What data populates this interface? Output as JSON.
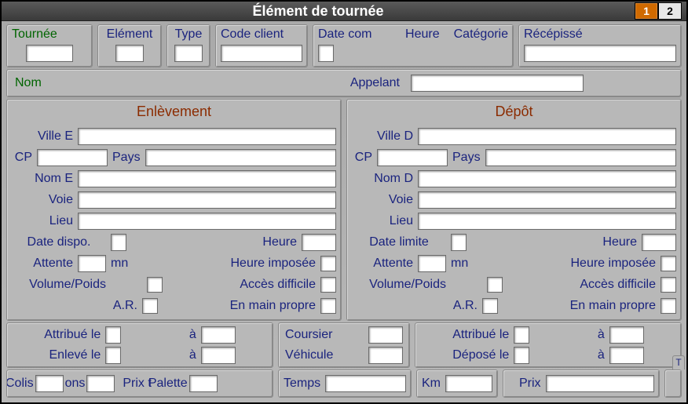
{
  "window": {
    "title": "Élément de tournée",
    "tabs": [
      "1",
      "2"
    ],
    "active_tab": "1"
  },
  "header": {
    "tournee": {
      "label": "Tournée",
      "value": ""
    },
    "element": {
      "label": "Elément",
      "value": ""
    },
    "type": {
      "label": "Type",
      "value": ""
    },
    "code_client": {
      "label": "Code client",
      "value": ""
    },
    "date_com": {
      "label": "Date com",
      "value": ""
    },
    "heure": {
      "label": "Heure",
      "value": ""
    },
    "categorie": {
      "label": "Catégorie",
      "value": ""
    },
    "recepisse": {
      "label": "Récépissé",
      "value": ""
    }
  },
  "identity": {
    "nom_label": "Nom",
    "nom": "",
    "appelant_label": "Appelant",
    "appelant": ""
  },
  "enlevement": {
    "title": "Enlèvement",
    "ville_label": "Ville E",
    "ville": "",
    "cp_label": "CP",
    "cp": "",
    "pays_label": "Pays",
    "pays": "",
    "nom_label": "Nom E",
    "nom": "",
    "voie_label": "Voie",
    "voie": "",
    "lieu_label": "Lieu",
    "lieu": "",
    "date_dispo_label": "Date dispo.",
    "date_dispo": "",
    "heure_label": "Heure",
    "heure": "",
    "attente_label": "Attente",
    "attente": "",
    "mn_label": "mn",
    "heure_imposee_label": "Heure imposée",
    "heure_imposee": "",
    "volpoids_label": "Volume/Poids",
    "volpoids": "",
    "acces_label": "Accès difficile",
    "acces": "",
    "ar_label": "A.R.",
    "ar": "",
    "enmain_label": "En main propre",
    "enmain": ""
  },
  "depot": {
    "title": "Dépôt",
    "ville_label": "Ville D",
    "ville": "",
    "cp_label": "CP",
    "cp": "",
    "pays_label": "Pays",
    "pays": "",
    "nom_label": "Nom D",
    "nom": "",
    "voie_label": "Voie",
    "voie": "",
    "lieu_label": "Lieu",
    "lieu": "",
    "date_limite_label": "Date limite",
    "date_limite": "",
    "heure_label": "Heure",
    "heure": "",
    "attente_label": "Attente",
    "attente": "",
    "mn_label": "mn",
    "heure_imposee_label": "Heure imposée",
    "heure_imposee": "",
    "volpoids_label": "Volume/Poids",
    "volpoids": "",
    "acces_label": "Accès difficile",
    "acces": "",
    "ar_label": "A.R.",
    "ar": "",
    "enmain_label": "En main propre",
    "enmain": ""
  },
  "assign": {
    "attribue_le_label": "Attribué le",
    "attribue_le": "",
    "a1_label": "à",
    "attribue_a": "",
    "enleve_le_label": "Enlevé le",
    "enleve_le": "",
    "a2_label": "à",
    "enleve_a": "",
    "coursier_label": "Coursier",
    "coursier": "",
    "vehicule_label": "Véhicule",
    "vehicule": "",
    "attribue2_le_label": "Attribué le",
    "attribue2_le": "",
    "a3_label": "à",
    "attribue2_a": "",
    "depose_le_label": "Déposé le",
    "depose_le": "",
    "a4_label": "à",
    "depose_a": ""
  },
  "footer": {
    "colis_label": "Colis",
    "colis": "",
    "ons_label": "ons",
    "ons": "",
    "prix_t_label": "Prix t",
    "prix_t": "",
    "palette_label": "Palette",
    "palette": "",
    "temps_label": "Temps",
    "temps": "",
    "km_label": "Km",
    "km": "",
    "prix_label": "Prix",
    "prix": "",
    "poids_tag": "T"
  }
}
